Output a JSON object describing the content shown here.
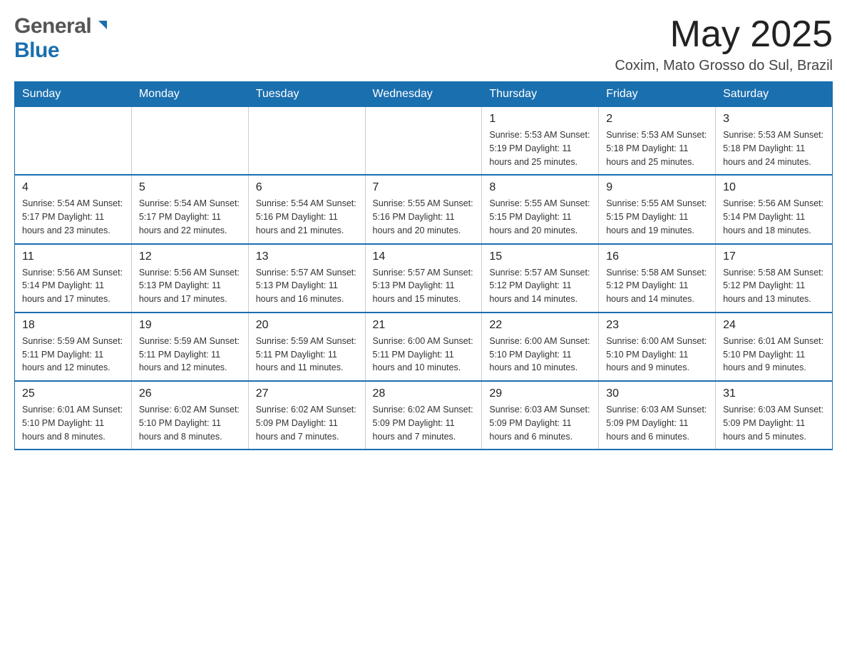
{
  "header": {
    "logo_general": "General",
    "logo_blue": "Blue",
    "month_title": "May 2025",
    "subtitle": "Coxim, Mato Grosso do Sul, Brazil"
  },
  "days_of_week": [
    "Sunday",
    "Monday",
    "Tuesday",
    "Wednesday",
    "Thursday",
    "Friday",
    "Saturday"
  ],
  "weeks": [
    {
      "cells": [
        {
          "day": "",
          "info": ""
        },
        {
          "day": "",
          "info": ""
        },
        {
          "day": "",
          "info": ""
        },
        {
          "day": "",
          "info": ""
        },
        {
          "day": "1",
          "info": "Sunrise: 5:53 AM\nSunset: 5:19 PM\nDaylight: 11 hours and 25 minutes."
        },
        {
          "day": "2",
          "info": "Sunrise: 5:53 AM\nSunset: 5:18 PM\nDaylight: 11 hours and 25 minutes."
        },
        {
          "day": "3",
          "info": "Sunrise: 5:53 AM\nSunset: 5:18 PM\nDaylight: 11 hours and 24 minutes."
        }
      ]
    },
    {
      "cells": [
        {
          "day": "4",
          "info": "Sunrise: 5:54 AM\nSunset: 5:17 PM\nDaylight: 11 hours and 23 minutes."
        },
        {
          "day": "5",
          "info": "Sunrise: 5:54 AM\nSunset: 5:17 PM\nDaylight: 11 hours and 22 minutes."
        },
        {
          "day": "6",
          "info": "Sunrise: 5:54 AM\nSunset: 5:16 PM\nDaylight: 11 hours and 21 minutes."
        },
        {
          "day": "7",
          "info": "Sunrise: 5:55 AM\nSunset: 5:16 PM\nDaylight: 11 hours and 20 minutes."
        },
        {
          "day": "8",
          "info": "Sunrise: 5:55 AM\nSunset: 5:15 PM\nDaylight: 11 hours and 20 minutes."
        },
        {
          "day": "9",
          "info": "Sunrise: 5:55 AM\nSunset: 5:15 PM\nDaylight: 11 hours and 19 minutes."
        },
        {
          "day": "10",
          "info": "Sunrise: 5:56 AM\nSunset: 5:14 PM\nDaylight: 11 hours and 18 minutes."
        }
      ]
    },
    {
      "cells": [
        {
          "day": "11",
          "info": "Sunrise: 5:56 AM\nSunset: 5:14 PM\nDaylight: 11 hours and 17 minutes."
        },
        {
          "day": "12",
          "info": "Sunrise: 5:56 AM\nSunset: 5:13 PM\nDaylight: 11 hours and 17 minutes."
        },
        {
          "day": "13",
          "info": "Sunrise: 5:57 AM\nSunset: 5:13 PM\nDaylight: 11 hours and 16 minutes."
        },
        {
          "day": "14",
          "info": "Sunrise: 5:57 AM\nSunset: 5:13 PM\nDaylight: 11 hours and 15 minutes."
        },
        {
          "day": "15",
          "info": "Sunrise: 5:57 AM\nSunset: 5:12 PM\nDaylight: 11 hours and 14 minutes."
        },
        {
          "day": "16",
          "info": "Sunrise: 5:58 AM\nSunset: 5:12 PM\nDaylight: 11 hours and 14 minutes."
        },
        {
          "day": "17",
          "info": "Sunrise: 5:58 AM\nSunset: 5:12 PM\nDaylight: 11 hours and 13 minutes."
        }
      ]
    },
    {
      "cells": [
        {
          "day": "18",
          "info": "Sunrise: 5:59 AM\nSunset: 5:11 PM\nDaylight: 11 hours and 12 minutes."
        },
        {
          "day": "19",
          "info": "Sunrise: 5:59 AM\nSunset: 5:11 PM\nDaylight: 11 hours and 12 minutes."
        },
        {
          "day": "20",
          "info": "Sunrise: 5:59 AM\nSunset: 5:11 PM\nDaylight: 11 hours and 11 minutes."
        },
        {
          "day": "21",
          "info": "Sunrise: 6:00 AM\nSunset: 5:11 PM\nDaylight: 11 hours and 10 minutes."
        },
        {
          "day": "22",
          "info": "Sunrise: 6:00 AM\nSunset: 5:10 PM\nDaylight: 11 hours and 10 minutes."
        },
        {
          "day": "23",
          "info": "Sunrise: 6:00 AM\nSunset: 5:10 PM\nDaylight: 11 hours and 9 minutes."
        },
        {
          "day": "24",
          "info": "Sunrise: 6:01 AM\nSunset: 5:10 PM\nDaylight: 11 hours and 9 minutes."
        }
      ]
    },
    {
      "cells": [
        {
          "day": "25",
          "info": "Sunrise: 6:01 AM\nSunset: 5:10 PM\nDaylight: 11 hours and 8 minutes."
        },
        {
          "day": "26",
          "info": "Sunrise: 6:02 AM\nSunset: 5:10 PM\nDaylight: 11 hours and 8 minutes."
        },
        {
          "day": "27",
          "info": "Sunrise: 6:02 AM\nSunset: 5:09 PM\nDaylight: 11 hours and 7 minutes."
        },
        {
          "day": "28",
          "info": "Sunrise: 6:02 AM\nSunset: 5:09 PM\nDaylight: 11 hours and 7 minutes."
        },
        {
          "day": "29",
          "info": "Sunrise: 6:03 AM\nSunset: 5:09 PM\nDaylight: 11 hours and 6 minutes."
        },
        {
          "day": "30",
          "info": "Sunrise: 6:03 AM\nSunset: 5:09 PM\nDaylight: 11 hours and 6 minutes."
        },
        {
          "day": "31",
          "info": "Sunrise: 6:03 AM\nSunset: 5:09 PM\nDaylight: 11 hours and 5 minutes."
        }
      ]
    }
  ]
}
